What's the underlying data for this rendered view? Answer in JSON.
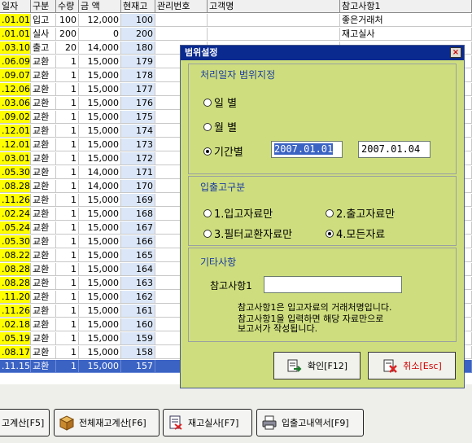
{
  "table": {
    "headers": {
      "date": "일자",
      "type": "구분",
      "qty": "수량",
      "amount": "금  액",
      "stock": "현재고",
      "mgmt": "관리번호",
      "customer": "고객명",
      "note": "참고사항1"
    },
    "rows": [
      {
        "date": ".01.01",
        "type": "입고",
        "qty": "100",
        "amount": "12,000",
        "stock": "100",
        "note": "좋은거래처"
      },
      {
        "date": ".01.01",
        "type": "실사",
        "qty": "200",
        "amount": "0",
        "stock": "200",
        "note": "재고실사"
      },
      {
        "date": ".03.10",
        "type": "출고",
        "qty": "20",
        "amount": "14,000",
        "stock": "180",
        "note": ""
      },
      {
        "date": ".06.09",
        "type": "교환",
        "qty": "1",
        "amount": "15,000",
        "stock": "179",
        "note": ""
      },
      {
        "date": ".09.07",
        "type": "교환",
        "qty": "1",
        "amount": "15,000",
        "stock": "178",
        "note": ""
      },
      {
        "date": ".12.06",
        "type": "교환",
        "qty": "1",
        "amount": "15,000",
        "stock": "177",
        "note": ""
      },
      {
        "date": ".03.06",
        "type": "교환",
        "qty": "1",
        "amount": "15,000",
        "stock": "176",
        "note": ""
      },
      {
        "date": ".09.02",
        "type": "교환",
        "qty": "1",
        "amount": "15,000",
        "stock": "175",
        "note": ""
      },
      {
        "date": ".12.01",
        "type": "교환",
        "qty": "1",
        "amount": "15,000",
        "stock": "174",
        "note": ""
      },
      {
        "date": ".12.01",
        "type": "교환",
        "qty": "1",
        "amount": "15,000",
        "stock": "173",
        "note": ""
      },
      {
        "date": ".03.01",
        "type": "교환",
        "qty": "1",
        "amount": "15,000",
        "stock": "172",
        "note": ""
      },
      {
        "date": ".05.30",
        "type": "교환",
        "qty": "1",
        "amount": "14,000",
        "stock": "171",
        "note": ""
      },
      {
        "date": ".08.28",
        "type": "교환",
        "qty": "1",
        "amount": "14,000",
        "stock": "170",
        "note": ""
      },
      {
        "date": ".11.26",
        "type": "교환",
        "qty": "1",
        "amount": "15,000",
        "stock": "169",
        "note": ""
      },
      {
        "date": ".02.24",
        "type": "교환",
        "qty": "1",
        "amount": "15,000",
        "stock": "168",
        "note": ""
      },
      {
        "date": ".05.24",
        "type": "교환",
        "qty": "1",
        "amount": "15,000",
        "stock": "167",
        "note": ""
      },
      {
        "date": ".05.30",
        "type": "교환",
        "qty": "1",
        "amount": "15,000",
        "stock": "166",
        "note": ""
      },
      {
        "date": ".08.22",
        "type": "교환",
        "qty": "1",
        "amount": "15,000",
        "stock": "165",
        "note": ""
      },
      {
        "date": ".08.28",
        "type": "교환",
        "qty": "1",
        "amount": "15,000",
        "stock": "164",
        "note": ""
      },
      {
        "date": ".08.28",
        "type": "교환",
        "qty": "1",
        "amount": "15,000",
        "stock": "163",
        "note": ""
      },
      {
        "date": ".11.20",
        "type": "교환",
        "qty": "1",
        "amount": "15,000",
        "stock": "162",
        "note": ""
      },
      {
        "date": ".11.26",
        "type": "교환",
        "qty": "1",
        "amount": "15,000",
        "stock": "161",
        "note": ""
      },
      {
        "date": ".02.18",
        "type": "교환",
        "qty": "1",
        "amount": "15,000",
        "stock": "160",
        "note": ""
      },
      {
        "date": ".05.19",
        "type": "교환",
        "qty": "1",
        "amount": "15,000",
        "stock": "159",
        "note": ""
      },
      {
        "date": ".08.17",
        "type": "교환",
        "qty": "1",
        "amount": "15,000",
        "stock": "158",
        "note": ""
      },
      {
        "date": ".11.15",
        "type": "교환",
        "qty": "1",
        "amount": "15,000",
        "stock": "157",
        "note": ""
      }
    ],
    "selected_row": 25
  },
  "toolbar": {
    "buttons": [
      {
        "label": "고계산[F5]",
        "icon": "calculator-icon"
      },
      {
        "label": "전체재고계산[F6]",
        "icon": "box-icon"
      },
      {
        "label": "재고실사[F7]",
        "icon": "audit-icon"
      },
      {
        "label": "입출고내역서[F9]",
        "icon": "printer-icon"
      }
    ]
  },
  "dialog": {
    "title": "범위설정",
    "close": "×",
    "range": {
      "title": "처리일자 범위지정",
      "options": [
        "일   별",
        "월   별",
        "기간별"
      ],
      "selected": 2,
      "from": "2007.01.01",
      "to": "2007.01.04"
    },
    "inout": {
      "title": "입출고구분",
      "options": [
        "1.입고자료만",
        "2.출고자료만",
        "3.필터교환자료만",
        "4.모든자료"
      ],
      "selected": 3
    },
    "etc": {
      "title": "기타사항",
      "field_label": "참고사항1",
      "field_value": "",
      "hint_lines": [
        "참고사항1은 입고자료의 거래처명입니다.",
        "참고사항1을 입력하면 해당 자료만으로",
        "보고서가 작성됩니다."
      ]
    },
    "ok_label": "확인[F12]",
    "cancel_label": "취소[Esc]",
    "colors": {
      "title_bar": "#0a2a8f",
      "body": "#cede7e",
      "section_title": "#1a3aa0",
      "cancel_text": "#cc0000"
    }
  }
}
